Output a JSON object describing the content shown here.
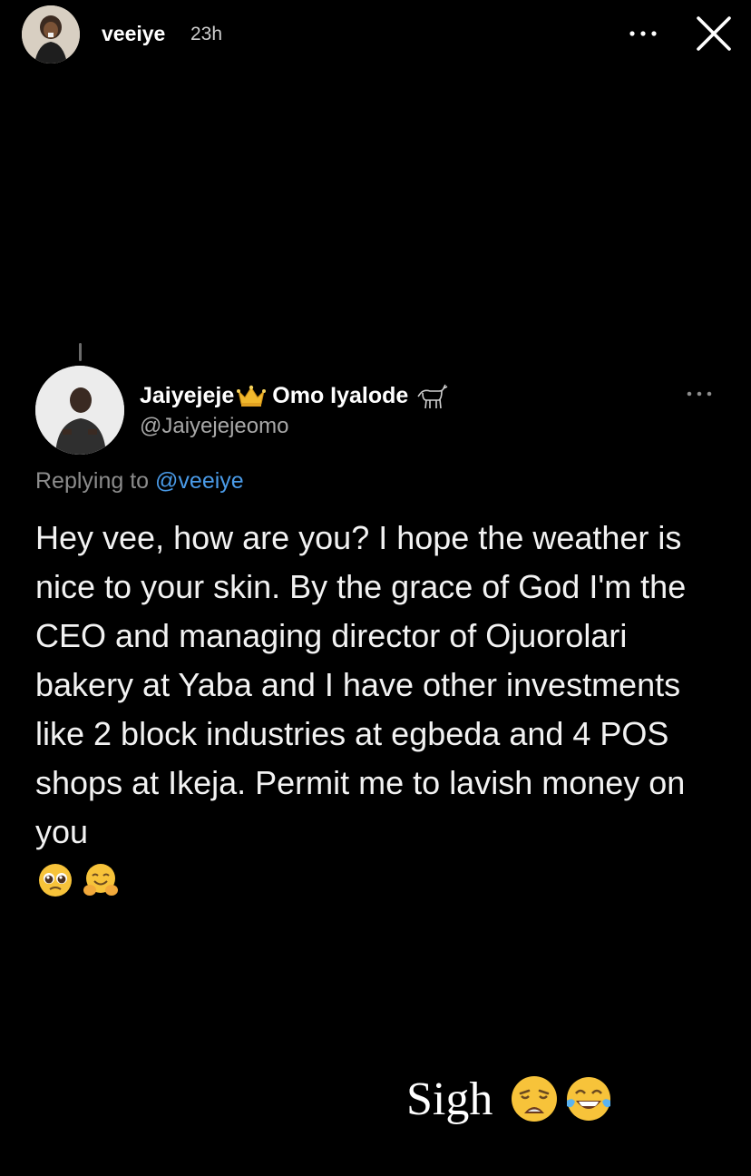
{
  "story": {
    "username": "veeiye",
    "time_ago": "23h",
    "icons": {
      "avatar": "profile-photo",
      "more": "more-horizontal-icon",
      "close": "close-icon"
    }
  },
  "tweet": {
    "display_name": "Jaiyejeje",
    "display_name_suffix": "Omo Iyalode",
    "name_emojis": [
      "crown-icon",
      "goat-icon"
    ],
    "handle": "@Jaiyejejeomo",
    "replying_prefix": "Replying to",
    "replying_to": "@veeiye",
    "body": "Hey vee, how are you? I hope the weather is nice to your skin. By the grace of God I'm the CEO and managing director of Ojuorolari bakery at Yaba and I have other investments like 2 block industries at egbeda and 4 POS shops at Ikeja. Permit me to lavish money on you",
    "body_emojis": [
      "pleading-face-icon",
      "hugging-face-icon"
    ]
  },
  "caption": {
    "text": "Sigh",
    "emojis": [
      "weary-face-icon",
      "tears-of-joy-icon"
    ]
  },
  "colors": {
    "background": "#000000",
    "text_primary": "#ffffff",
    "text_secondary": "#8c8c8c",
    "mention": "#4a9be8",
    "emoji_yellow": "#f7c33a"
  }
}
